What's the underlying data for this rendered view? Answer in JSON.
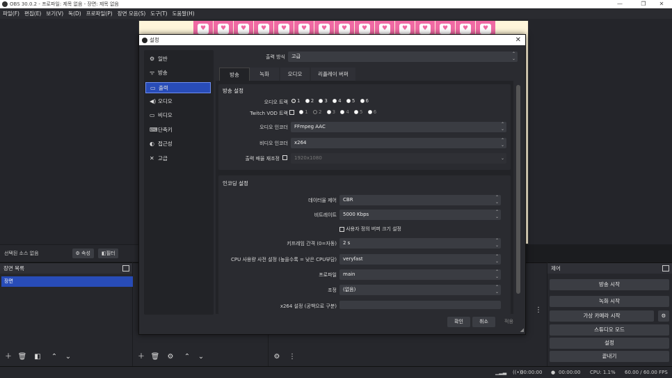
{
  "window": {
    "title": "OBS 30.0.2 - 프로파일: 제목 없음 - 장면: 제목 없음"
  },
  "menu": [
    "파일(F)",
    "편집(E)",
    "보기(V)",
    "독(D)",
    "프로파일(P)",
    "장면 모음(S)",
    "도구(T)",
    "도움말(H)"
  ],
  "source_toolbar": {
    "no_source": "선택된 소스 없음",
    "properties": "속성",
    "filters": "필터"
  },
  "scenes_dock": {
    "title": "장면 목록",
    "items": [
      "장면"
    ]
  },
  "controls_dock": {
    "title": "제어",
    "buttons": [
      "방송 시작",
      "녹화 시작",
      "가상 카메라 시작",
      "스튜디오 모드",
      "설정",
      "끝내기"
    ]
  },
  "statusbar": {
    "stream_time": "00:00:00",
    "rec_time": "00:00:00",
    "cpu": "CPU: 1.1%",
    "fps": "60.00 / 60.00 FPS"
  },
  "dialog": {
    "title": "설정",
    "categories": [
      "일반",
      "방송",
      "출력",
      "오디오",
      "비디오",
      "단축키",
      "접근성",
      "고급"
    ],
    "selected_category": "출력",
    "output_mode_label": "출력 방식",
    "output_mode_value": "고급",
    "tabs": [
      "방송",
      "녹화",
      "오디오",
      "리플레이 버퍼"
    ],
    "selected_tab": "방송",
    "stream_section": {
      "title": "방송 설정",
      "audio_track_label": "오디오 트랙",
      "tracks": [
        "1",
        "2",
        "3",
        "4",
        "5",
        "6"
      ],
      "twitch_vod_label": "Twitch VOD 트랙",
      "audio_encoder_label": "오디오 인코더",
      "audio_encoder_value": "FFmpeg AAC",
      "video_encoder_label": "비디오 인코더",
      "video_encoder_value": "x264",
      "rescale_label": "출력 배율 재조정",
      "rescale_value": "1920x1080"
    },
    "encoder_section": {
      "title": "인코딩 설정",
      "rate_control_label": "데이터율 제어",
      "rate_control_value": "CBR",
      "bitrate_label": "비트레이트",
      "bitrate_value": "5000 Kbps",
      "custom_buffer_label": "사용자 정의 버퍼 크기 설정",
      "keyframe_label": "키프레임 간격 (0=자동)",
      "keyframe_value": "2 s",
      "cpu_preset_label": "CPU 사용량 사전 설정 (높을수록 = 낮은 CPU부담)",
      "cpu_preset_value": "veryfast",
      "profile_label": "프로파일",
      "profile_value": "main",
      "tune_label": "조정",
      "tune_value": "(없음)",
      "x264_opts_label": "x264 설정 (공백으로 구분)",
      "x264_opts_value": ""
    },
    "buttons": {
      "ok": "확인",
      "cancel": "취소",
      "apply": "적용"
    }
  }
}
